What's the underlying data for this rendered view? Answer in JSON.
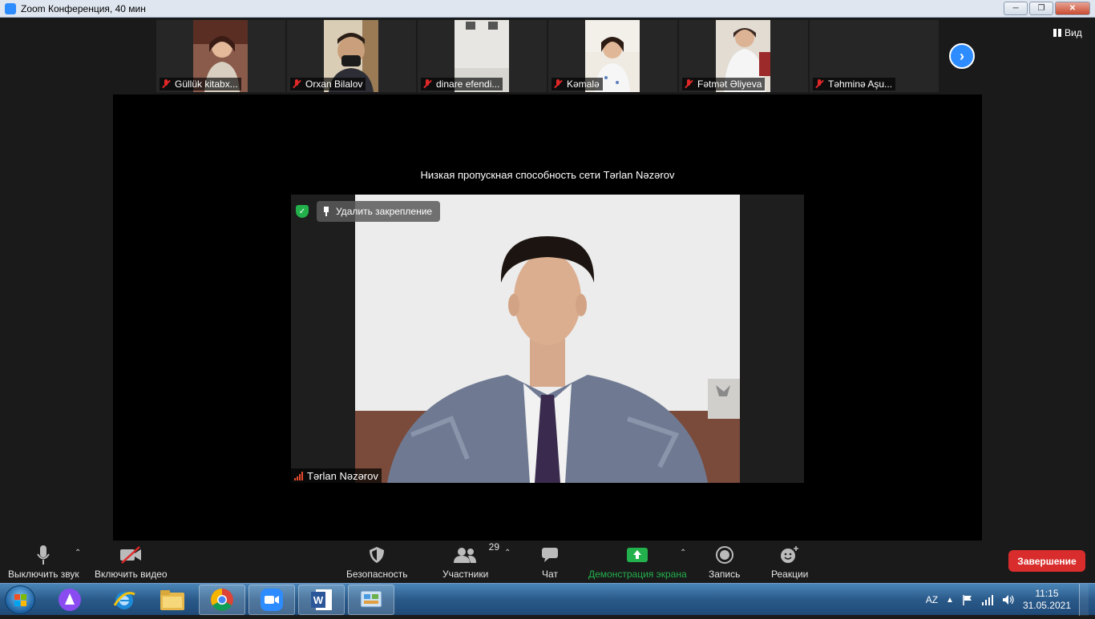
{
  "window": {
    "title": "Zoom Конференция, 40 мин",
    "controls": [
      "minimize",
      "restore",
      "close"
    ]
  },
  "participants_strip": [
    {
      "name": "Güllük kitabx...",
      "mic": "muted"
    },
    {
      "name": "Orxan Bilalov",
      "mic": "muted"
    },
    {
      "name": "dinare efendi...",
      "mic": "muted"
    },
    {
      "name": "Kəmalə",
      "mic": "muted"
    },
    {
      "name": "Fətmət Əliyeva",
      "mic": "muted"
    },
    {
      "name": "Təhminə Aşu...",
      "mic": "muted"
    }
  ],
  "view": {
    "label": "Вид"
  },
  "main": {
    "notice": "Низкая пропускная способность сети Tərlan Nəzərov",
    "unpin_label": "Удалить закрепление",
    "speaker_name": "Tərlan Nəzərov"
  },
  "toolbar": {
    "mute_label": "Выключить звук",
    "video_label": "Включить видео",
    "security_label": "Безопасность",
    "participants_label": "Участники",
    "participants_count": "29",
    "chat_label": "Чат",
    "share_label": "Демонстрация экрана",
    "record_label": "Запись",
    "reactions_label": "Реакции",
    "end_label": "Завершение"
  },
  "taskbar": {
    "apps": [
      "start-button",
      "alice-assistant",
      "internet-explorer",
      "file-explorer",
      "chrome",
      "zoom",
      "word",
      "control-panel"
    ],
    "language": "AZ",
    "time": "11:15",
    "date": "31.05.2021"
  },
  "colors": {
    "zoom_blue": "#2d8cff",
    "end_red": "#d92d2d",
    "share_green": "#23b14d",
    "mute_red": "#e02828"
  }
}
